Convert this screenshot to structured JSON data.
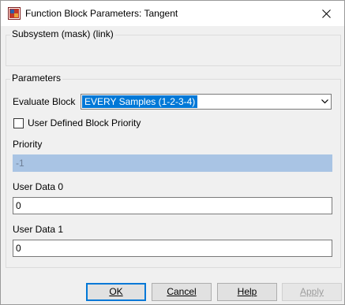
{
  "window": {
    "title": "Function Block Parameters: Tangent"
  },
  "subsystem": {
    "label": "Subsystem (mask) (link)"
  },
  "parameters": {
    "label": "Parameters",
    "evaluate_block_label": "Evaluate Block",
    "evaluate_block_value": "EVERY Samples (1-2-3-4)",
    "user_priority_label": "User Defined Block Priority",
    "user_priority_checked": false,
    "priority_label": "Priority",
    "priority_value": "-1",
    "user_data_0_label": "User Data 0",
    "user_data_0_value": "0",
    "user_data_1_label": "User Data 1",
    "user_data_1_value": "0"
  },
  "buttons": {
    "ok": "OK",
    "cancel": "Cancel",
    "help": "Help",
    "apply": "Apply"
  },
  "colors": {
    "accent": "#0078d7",
    "disabled_field": "#a9c4e4",
    "dialog_bg": "#f0f0f0"
  },
  "icons": {
    "app": "simulink-block-icon",
    "close": "close-icon",
    "dropdown": "chevron-down-icon"
  }
}
